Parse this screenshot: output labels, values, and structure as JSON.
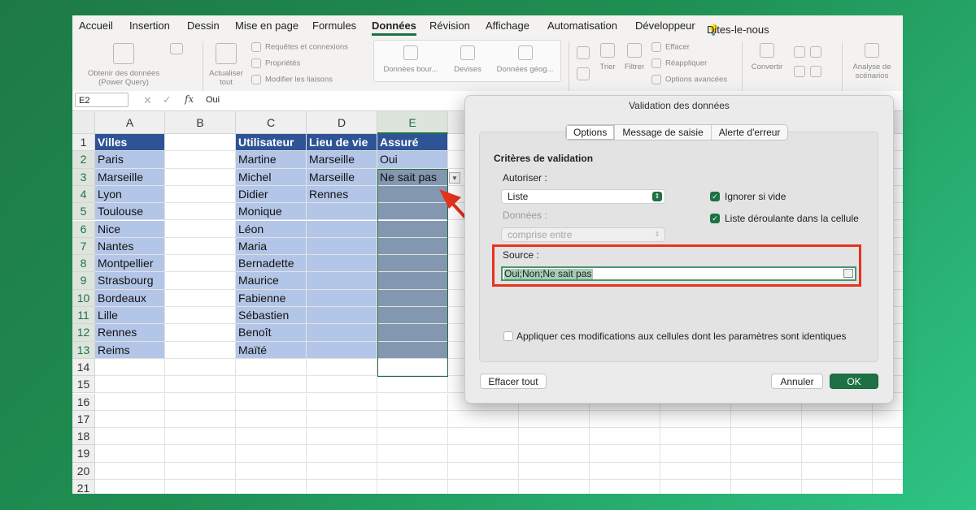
{
  "menu": {
    "items": [
      "Accueil",
      "Insertion",
      "Dessin",
      "Mise en page",
      "Formules",
      "Données",
      "Révision",
      "Affichage",
      "Automatisation",
      "Développeur"
    ],
    "help": "Dites-le-nous"
  },
  "ribbon": {
    "get_data": "Obtenir des données (Power Query)",
    "refresh_all": "Actualiser tout",
    "queries": "Requêtes et connexions",
    "properties": "Propriétés",
    "edit_links": "Modifier les liaisons",
    "stocks": "Données bour...",
    "currencies": "Devises",
    "geo": "Données géog...",
    "sort": "Trier",
    "filter": "Filtrer",
    "clear": "Effacer",
    "reapply": "Réappliquer",
    "advanced": "Options avancées",
    "convert": "Convertir",
    "scenarios": "Analyse de scénarios"
  },
  "formula_bar": {
    "cell_ref": "E2",
    "fx": "fx",
    "value": "Oui"
  },
  "sheet": {
    "columns": [
      "A",
      "B",
      "C",
      "D",
      "E"
    ],
    "rows": [
      "1",
      "2",
      "3",
      "4",
      "5",
      "6",
      "7",
      "8",
      "9",
      "10",
      "11",
      "12",
      "13",
      "14",
      "15",
      "16",
      "17",
      "18",
      "19",
      "20",
      "21"
    ],
    "headers": {
      "A": "Villes",
      "C": "Utilisateur",
      "D": "Lieu de vie",
      "E": "Assuré"
    },
    "villes": [
      "Paris",
      "Marseille",
      "Lyon",
      "Toulouse",
      "Nice",
      "Nantes",
      "Montpellier",
      "Strasbourg",
      "Bordeaux",
      "Lille",
      "Rennes",
      "Reims"
    ],
    "utilisateurs": [
      "Martine",
      "Michel",
      "Didier",
      "Monique",
      "Léon",
      "Maria",
      "Bernadette",
      "Maurice",
      "Fabienne",
      "Sébastien",
      "Benoît",
      "Maïté"
    ],
    "lieux": [
      "Marseille",
      "Marseille",
      "Rennes"
    ],
    "assure": [
      "Oui",
      "Ne sait pas"
    ]
  },
  "dialog": {
    "title": "Validation des données",
    "tabs": [
      "Options",
      "Message de saisie",
      "Alerte d'erreur"
    ],
    "criteria_title": "Critères de validation",
    "allow_label": "Autoriser :",
    "allow_value": "Liste",
    "data_label": "Données :",
    "data_value": "comprise entre",
    "ignore_blank": "Ignorer si vide",
    "in_cell_dropdown": "Liste déroulante dans la cellule",
    "source_label": "Source :",
    "source_value": "Oui;Non;Ne sait pas",
    "apply_all": "Appliquer ces modifications aux cellules dont les paramètres sont identiques",
    "clear_all": "Effacer tout",
    "cancel": "Annuler",
    "ok": "OK"
  },
  "colors": {
    "accent": "#1e7145",
    "header_blue": "#2f5496",
    "light_blue": "#b4c6e7",
    "highlight_red": "#e8321c"
  }
}
